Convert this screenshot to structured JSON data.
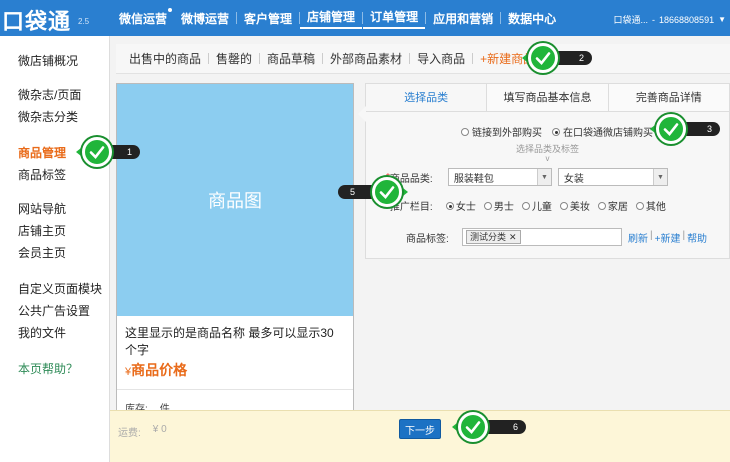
{
  "brand": {
    "logo": "口袋通",
    "version": "2.5"
  },
  "topnav": [
    {
      "label": "微信运营"
    },
    {
      "label": "微博运营"
    },
    {
      "label": "客户管理"
    },
    {
      "label": "店铺管理"
    },
    {
      "label": "订单管理"
    },
    {
      "label": "应用和营销"
    },
    {
      "label": "数据中心"
    }
  ],
  "account": {
    "name": "口袋通...",
    "phone": "18668808591"
  },
  "sidebar": {
    "items": [
      "微店铺概况",
      "微杂志/页面",
      "微杂志分类",
      "商品管理",
      "商品标签",
      "网站导航",
      "店铺主页",
      "会员主页",
      "自定义页面模块",
      "公共广告设置",
      "我的文件",
      "本页帮助？"
    ]
  },
  "subtabs": [
    "出售中的商品",
    "售罄的",
    "商品草稿",
    "外部商品素材",
    "导入商品",
    "+新建商品"
  ],
  "preview": {
    "image_label": "商品图",
    "name": "这里显示的是商品名称 最多可以显示30个字",
    "price_prefix": "¥",
    "price": "商品价格",
    "stock_label": "库存:",
    "stock_unit": "件"
  },
  "steps": [
    "选择品类",
    "填写商品基本信息",
    "完善商品详情"
  ],
  "source_options": [
    "链接到外部购买",
    "在口袋通微店铺购买"
  ],
  "section_title": "选择品类及标签",
  "form": {
    "category_label": "商品品类:",
    "category_value": "服装鞋包",
    "subcategory_value": "女装",
    "column_label": "推广栏目:",
    "columns": [
      "女士",
      "男士",
      "儿童",
      "美妆",
      "家居",
      "其他"
    ],
    "tag_label": "商品标签:",
    "tag_value": "测试分类",
    "refresh": "刷新",
    "new": "+新建",
    "help": "帮助"
  },
  "footer": {
    "freight_label": "运费:",
    "freight_value": "¥ 0",
    "next": "下一步"
  },
  "callouts": [
    "1",
    "2",
    "3",
    "5",
    "6"
  ],
  "colors": {
    "nav": "#2a7fd0",
    "accent": "#e96b1a",
    "check": "#20b53a",
    "preview": "#8ccdf0"
  }
}
